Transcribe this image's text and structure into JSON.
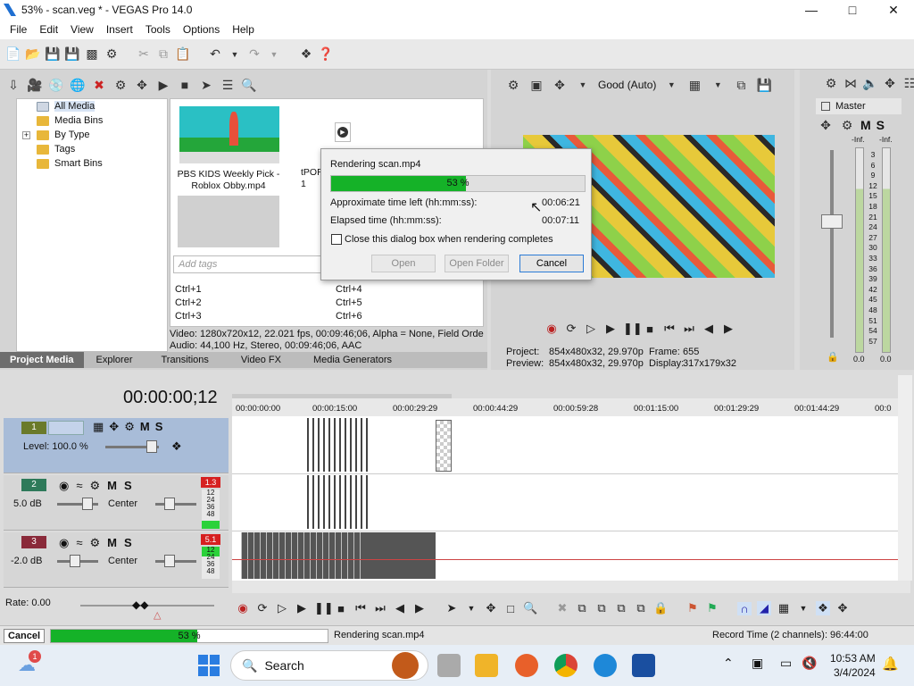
{
  "window": {
    "title": "53% - scan.veg * - VEGAS Pro 14.0",
    "controls": [
      "minimize-icon",
      "maximize-icon",
      "close-icon"
    ]
  },
  "menu": [
    "File",
    "Edit",
    "View",
    "Insert",
    "Tools",
    "Options",
    "Help"
  ],
  "project_media": {
    "tree": [
      "All Media",
      "Media Bins",
      "By Type",
      "Tags",
      "Smart Bins"
    ],
    "tree_expander": "+",
    "item_caption": "PBS KIDS Weekly Pick - Roblox Obby.mp4",
    "second_item_partial": "tPOR\n1",
    "tags_placeholder": "Add tags",
    "shortcuts_left": [
      "Ctrl+1",
      "Ctrl+2",
      "Ctrl+3"
    ],
    "shortcuts_right": [
      "Ctrl+4",
      "Ctrl+5",
      "Ctrl+6"
    ],
    "info_video": "Video: 1280x720x12, 22.021 fps, 00:09:46;06, Alpha = None, Field Orde",
    "info_audio": "Audio: 44,100 Hz, Stereo, 00:09:46;06, AAC"
  },
  "tabs": [
    "Project Media",
    "Explorer",
    "Transitions",
    "Video FX",
    "Media Generators"
  ],
  "preview": {
    "quality": "Good (Auto)",
    "project_label": "Project:",
    "project_value": "854x480x32, 29.970p",
    "frame_label": "Frame:",
    "frame_value": "655",
    "preview_label": "Preview:",
    "preview_value": "854x480x32, 29.970p",
    "display_label": "Display:",
    "display_value": "317x179x32"
  },
  "mixer": {
    "title": "Master",
    "left_peak": "-Inf.",
    "right_peak": "-Inf.",
    "scale": [
      "3",
      "6",
      "9",
      "12",
      "15",
      "18",
      "21",
      "24",
      "27",
      "30",
      "33",
      "36",
      "39",
      "42",
      "45",
      "48",
      "51",
      "54",
      "57"
    ],
    "left_level": "0.0",
    "right_level": "0.0"
  },
  "render_dialog": {
    "title": "Rendering scan.mp4",
    "progress_text": "53 %",
    "progress": 0.53,
    "time_left_label": "Approximate time left (hh:mm:ss):",
    "time_left_value": "00:06:21",
    "elapsed_label": "Elapsed time (hh:mm:ss):",
    "elapsed_value": "00:07:11",
    "checkbox_label": "Close this dialog box when rendering completes",
    "buttons": {
      "open": "Open",
      "open_folder": "Open Folder",
      "cancel": "Cancel"
    }
  },
  "timeline": {
    "timecode": "00:00:00;12",
    "ruler": [
      "00:00:00:00",
      "00:00:15:00",
      "00:00:29:29",
      "00:00:44:29",
      "00:00:59:28",
      "00:01:15:00",
      "00:01:29:29",
      "00:01:44:29",
      "00:0"
    ],
    "tracks": [
      {
        "num": "1",
        "level": "Level: 100.0 %",
        "color": "#6a7a2a"
      },
      {
        "num": "2",
        "vol": "5.0 dB",
        "pan": "Center",
        "color": "#2e7a5a",
        "peak": "1.3"
      },
      {
        "num": "3",
        "vol": "-2.0 dB",
        "pan": "Center",
        "color": "#8a2a3a",
        "peak": "5.1"
      }
    ],
    "track_meter_ticks": [
      "12",
      "24",
      "36",
      "48"
    ],
    "mute": "M",
    "solo": "S",
    "rate": "Rate: 0.00"
  },
  "status": {
    "cancel": "Cancel",
    "progress_text": "53 %",
    "progress": 0.53,
    "message": "Rendering scan.mp4",
    "record_time": "Record Time (2 channels): 96:44:00"
  },
  "taskbar": {
    "search": "Search",
    "time": "10:53 AM",
    "date": "3/4/2024",
    "weather_badge": "1"
  }
}
